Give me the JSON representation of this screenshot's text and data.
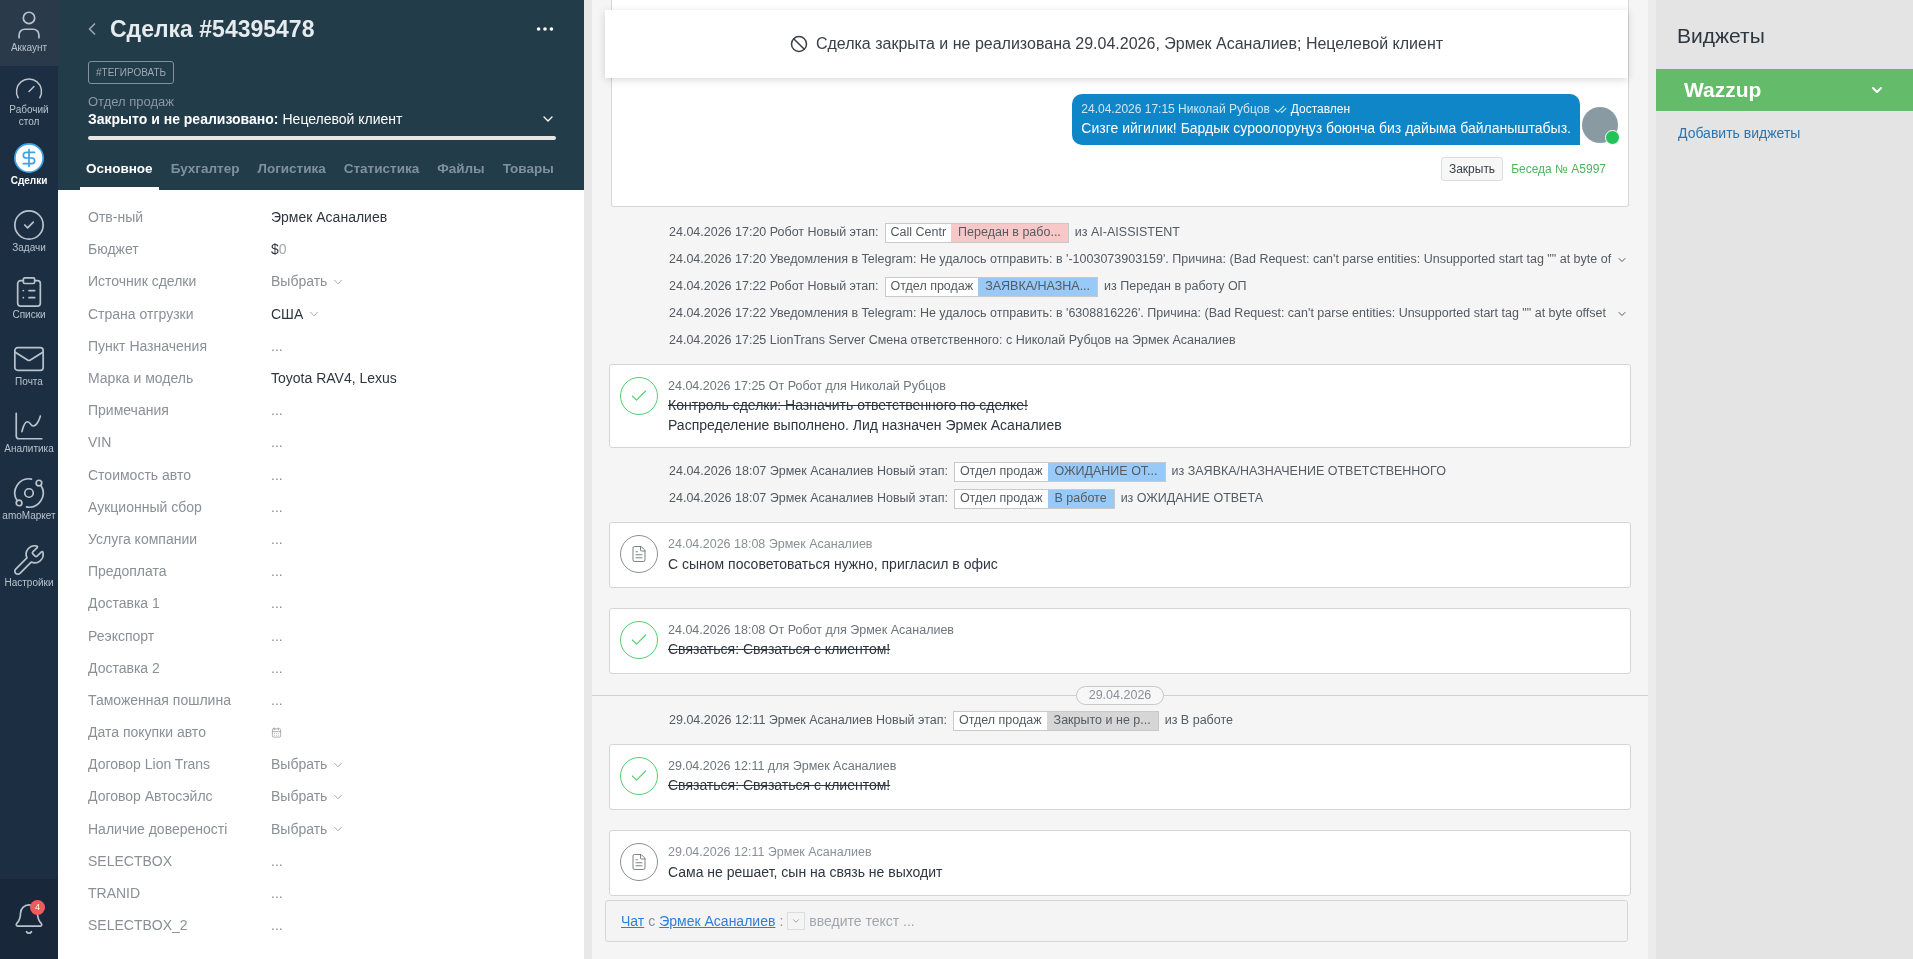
{
  "nav": {
    "items": [
      {
        "label": "Аккаунт",
        "selected": false
      },
      {
        "label": "Рабочий стол",
        "selected": false
      },
      {
        "label": "Сделки",
        "selected": true
      },
      {
        "label": "Задачи",
        "selected": false
      },
      {
        "label": "Списки",
        "selected": false
      },
      {
        "label": "Почта",
        "selected": false
      },
      {
        "label": "Аналитика",
        "selected": false
      },
      {
        "label": "amoМаркет",
        "selected": false
      },
      {
        "label": "Настройки",
        "selected": false
      }
    ],
    "notifications": "4"
  },
  "deal": {
    "title": "Сделка #54395478",
    "tag_button": "#ТЕГИРОВАТЬ",
    "pipeline": "Отдел продаж",
    "status": "Закрыто и не реализовано:",
    "reason": "Нецелевой клиент",
    "tabs": [
      {
        "label": "Основное",
        "selected": true
      },
      {
        "label": "Бухгалтер",
        "selected": false
      },
      {
        "label": "Логистика",
        "selected": false
      },
      {
        "label": "Статистика",
        "selected": false
      },
      {
        "label": "Файлы",
        "selected": false
      },
      {
        "label": "Товары",
        "selected": false
      }
    ],
    "fields": [
      {
        "label": "Отв-ный",
        "kind": "text",
        "value": "Эрмек Асаналиев"
      },
      {
        "label": "Бюджет",
        "kind": "money",
        "currency": "$",
        "value": "0"
      },
      {
        "label": "Источник сделки",
        "kind": "select",
        "placeholder": "Выбрать"
      },
      {
        "label": "Страна отгрузки",
        "kind": "select",
        "value": "США"
      },
      {
        "label": "Пункт Назначения",
        "kind": "empty",
        "placeholder": "..."
      },
      {
        "label": "Марка и модель",
        "kind": "text",
        "value": "Toyota RAV4, Lexus"
      },
      {
        "label": "Примечания",
        "kind": "empty",
        "placeholder": "..."
      },
      {
        "label": "VIN",
        "kind": "empty",
        "placeholder": "..."
      },
      {
        "label": "Стоимость авто",
        "kind": "empty",
        "placeholder": "..."
      },
      {
        "label": "Аукционный сбор",
        "kind": "empty",
        "placeholder": "..."
      },
      {
        "label": "Услуга компании",
        "kind": "empty",
        "placeholder": "..."
      },
      {
        "label": "Предоплата",
        "kind": "empty",
        "placeholder": "..."
      },
      {
        "label": "Доставка 1",
        "kind": "empty",
        "placeholder": "..."
      },
      {
        "label": "Реэкспорт",
        "kind": "empty",
        "placeholder": "..."
      },
      {
        "label": "Доставка 2",
        "kind": "empty",
        "placeholder": "..."
      },
      {
        "label": "Таможенная пошлина",
        "kind": "empty",
        "placeholder": "..."
      },
      {
        "label": "Дата покупки авто",
        "kind": "date"
      },
      {
        "label": "Договор Lion Trans",
        "kind": "select",
        "placeholder": "Выбрать"
      },
      {
        "label": "Договор Автосэйлс",
        "kind": "select",
        "placeholder": "Выбрать"
      },
      {
        "label": "Наличие довереностi",
        "kind": "select",
        "placeholder": "Выбрать"
      },
      {
        "label": "SELECTBOX",
        "kind": "empty",
        "placeholder": "..."
      },
      {
        "label": "TRANID",
        "kind": "empty",
        "placeholder": "..."
      },
      {
        "label": "SELECTBOX_2",
        "kind": "empty",
        "placeholder": "..."
      }
    ]
  },
  "timeline": {
    "banner": "Сделка закрыта и не реализована 29.04.2026, Эрмек Асаналиев; Нецелевой клиент",
    "message": {
      "meta": "24.04.2026 17:15 Николай Рубцов",
      "status": "Доставлен",
      "text": "Сизге ийгилик! Бардык суроолоруңуз боюнча биз дайыма байланыштабыз.",
      "close_button": "Закрыть",
      "conversation": "Беседа № A5997"
    },
    "events": [
      {
        "kind": "stage",
        "meta": "24.04.2026 17:20 Робот Новый этап:",
        "pipeline": "Call Centr",
        "stage": "Передан в рабо...",
        "color": "#f8c8c8",
        "suffix": "из AI-AISSISTENT"
      },
      {
        "kind": "log",
        "text": "24.04.2026 17:20 Уведомления в Telegram: Не удалось отправить: в '-1003073903159'. Причина: (Bad Request: can't parse entities: Unsupported start tag \"\" at byte of",
        "expandable": true
      },
      {
        "kind": "stage",
        "meta": "24.04.2026 17:22 Робот Новый этап:",
        "pipeline": "Отдел продаж",
        "stage": "ЗАЯВКА/НАЗНА...",
        "color": "#99c9f7",
        "suffix": "из Передан в работу ОП"
      },
      {
        "kind": "log",
        "text": "24.04.2026 17:22 Уведомления в Telegram: Не удалось отправить: в '6308816226'. Причина: (Bad Request: can't parse entities: Unsupported start tag \"\" at byte offset",
        "expandable": true
      },
      {
        "kind": "log",
        "text": "24.04.2026 17:25 LionTrans Server Смена ответственного: с Николай Рубцов на Эрмек Асаналиев",
        "expandable": false
      },
      {
        "kind": "task",
        "meta": "24.04.2026 17:25  От Робот для Николай Рубцов",
        "lines": [
          {
            "text": "Контроль сделки: Назначить ответственного по сделке!",
            "done": true
          },
          {
            "text": "Распределение выполнено. Лид назначен Эрмек Асаналиев",
            "done": false
          }
        ]
      },
      {
        "kind": "stage",
        "meta": "24.04.2026 18:07 Эрмек Асаналиев Новый этап:",
        "pipeline": "Отдел продаж",
        "stage": "ОЖИДАНИЕ ОТ...",
        "color": "#99c9f7",
        "suffix": "из ЗАЯВКА/НАЗНАЧЕНИЕ ОТВЕТСТВЕННОГО"
      },
      {
        "kind": "stage",
        "meta": "24.04.2026 18:07 Эрмек Асаналиев Новый этап:",
        "pipeline": "Отдел продаж",
        "stage": "В работе",
        "color": "#99c9f7",
        "suffix": "из ОЖИДАНИЕ ОТВЕТА"
      },
      {
        "kind": "note",
        "meta": "24.04.2026 18:08 Эрмек Асаналиев",
        "text": "С сыном посоветоваться нужно, пригласил в офис"
      },
      {
        "kind": "task",
        "meta": "24.04.2026 18:08  От Робот для Эрмек Асаналиев",
        "lines": [
          {
            "text": "Связаться: Связаться с клиентом!",
            "done": true
          }
        ]
      },
      {
        "kind": "date",
        "text": "29.04.2026"
      },
      {
        "kind": "stage",
        "meta": "29.04.2026 12:11 Эрмек Асаналиев Новый этап:",
        "pipeline": "Отдел продаж",
        "stage": "Закрыто и не р...",
        "color": "#d6d6d6",
        "suffix": "из В работе"
      },
      {
        "kind": "task",
        "meta": "29.04.2026 12:11  для Эрмек Асаналиев",
        "lines": [
          {
            "text": "Связаться: Связаться с клиентом!",
            "done": true
          }
        ]
      },
      {
        "kind": "note",
        "meta": "29.04.2026 12:11 Эрмек Асаналиев",
        "text": "Сама не решает, сын на связь не выходит"
      }
    ],
    "chat": {
      "link": "Чат",
      "with": "с",
      "contact": "Эрмек Асаналиев",
      "colon": ":",
      "placeholder": "введите текст ..."
    }
  },
  "widgets": {
    "title": "Виджеты",
    "items": [
      {
        "name": "Wazzup",
        "expanded": false
      }
    ],
    "add_link": "Добавить виджеты"
  }
}
